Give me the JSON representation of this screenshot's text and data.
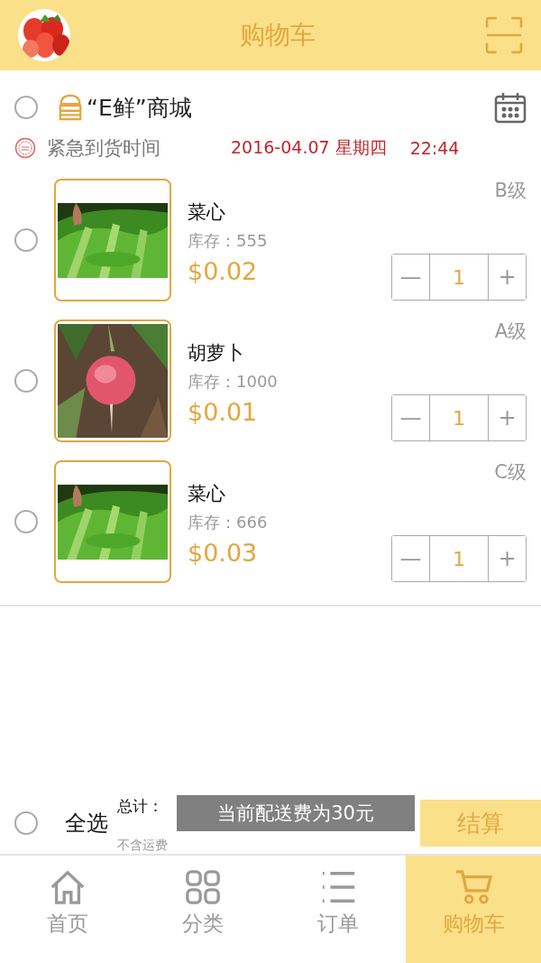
{
  "header": {
    "title": "购物车"
  },
  "store": {
    "name": "“E鲜”商城",
    "checked": false
  },
  "urgent": {
    "label": "紧急到货时间",
    "date": "2016-04.07 星期四",
    "time": "22:44"
  },
  "items": [
    {
      "name": "菜心",
      "stock": "库存：555",
      "price": "$0.02",
      "grade": "B级",
      "qty": "1",
      "minus": "—",
      "plus": "+",
      "checked": false
    },
    {
      "name": "胡萝卜",
      "stock": "库存：1000",
      "price": "$0.01",
      "grade": "A级",
      "qty": "1",
      "minus": "—",
      "plus": "+",
      "checked": false
    },
    {
      "name": "菜心",
      "stock": "库存：666",
      "price": "$0.03",
      "grade": "C级",
      "qty": "1",
      "minus": "—",
      "plus": "+",
      "checked": false
    }
  ],
  "footer": {
    "select_all": "全选",
    "checked": false,
    "total_label": "总计：",
    "note": "不含运费",
    "checkout": "结算"
  },
  "toast": "当前配送费为30元",
  "tabs": [
    {
      "label": "首页",
      "selected": false
    },
    {
      "label": "分类",
      "selected": false
    },
    {
      "label": "订单",
      "selected": false
    },
    {
      "label": "购物车",
      "selected": true
    }
  ]
}
